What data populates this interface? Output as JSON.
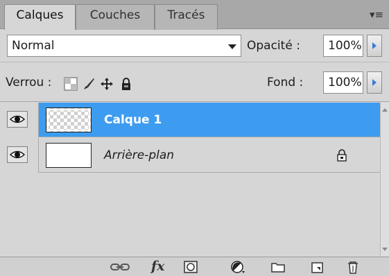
{
  "tabs": [
    {
      "label": "Calques",
      "active": true
    },
    {
      "label": "Couches",
      "active": false
    },
    {
      "label": "Tracés",
      "active": false
    }
  ],
  "panel_menu_icon": "panel-menu-icon",
  "blend": {
    "mode": "Normal",
    "opacity_label": "Opacité :",
    "opacity_value": "100%"
  },
  "lock": {
    "label": "Verrou :",
    "icons": [
      "lock-transparent-pixels-icon",
      "lock-image-pixels-icon",
      "lock-position-icon",
      "lock-all-icon"
    ],
    "fill_label": "Fond :",
    "fill_value": "100%"
  },
  "layers": [
    {
      "name": "Calque 1",
      "selected": true,
      "visible": true,
      "thumbnail": "transparent",
      "locked": false
    },
    {
      "name": "Arrière-plan",
      "selected": false,
      "visible": true,
      "thumbnail": "white",
      "locked": true,
      "italic": true
    }
  ],
  "toolbar": {
    "fx_label": "fx",
    "icons": [
      "link-layers-icon",
      "layer-style-icon",
      "add-mask-icon",
      "adjustment-layer-icon",
      "new-group-icon",
      "new-layer-icon",
      "delete-layer-icon"
    ]
  },
  "colors": {
    "selection": "#3d9cf0",
    "panel_bg": "#d6d6d6",
    "stepper_arrow": "#3a7bd5"
  }
}
